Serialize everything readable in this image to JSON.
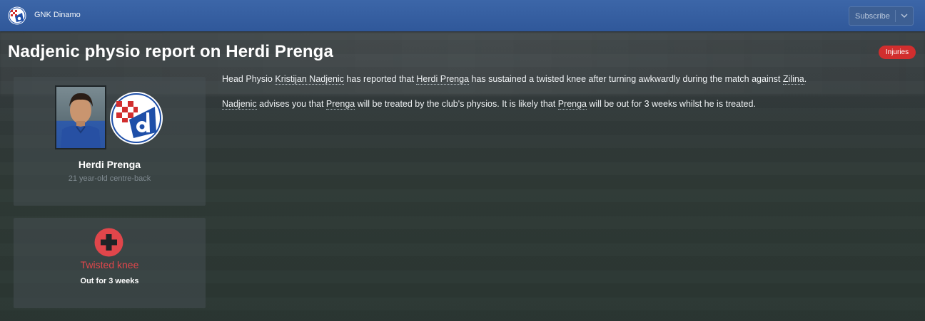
{
  "header": {
    "club_name": "GNK Dinamo",
    "subscribe_label": "Subscribe"
  },
  "title": "Nadjenic physio report on Herdi Prenga",
  "tag": "Injuries",
  "player": {
    "name": "Herdi Prenga",
    "description": "21 year-old centre-back"
  },
  "injury": {
    "name": "Twisted knee",
    "duration": "Out for 3 weeks"
  },
  "message": {
    "p1": [
      "Head Physio ",
      "Kristijan Nadjenic",
      " has reported that ",
      "Herdi Prenga",
      " has sustained a twisted knee after turning awkwardly during the match against ",
      "Zilina",
      "."
    ],
    "p2": [
      "Nadjenic",
      " advises you that ",
      "Prenga",
      " will be treated by the club's physios. It is likely that ",
      "Prenga",
      " will be out for 3 weeks whilst he is treated."
    ]
  },
  "colors": {
    "topbar": "#30589a",
    "tag_red": "#d12e2e",
    "injury_red": "#e0464b",
    "badge_blue": "#1e4fa8"
  },
  "icons": [
    "dinamo-crest-icon",
    "chevron-down-icon",
    "medical-cross-icon"
  ]
}
